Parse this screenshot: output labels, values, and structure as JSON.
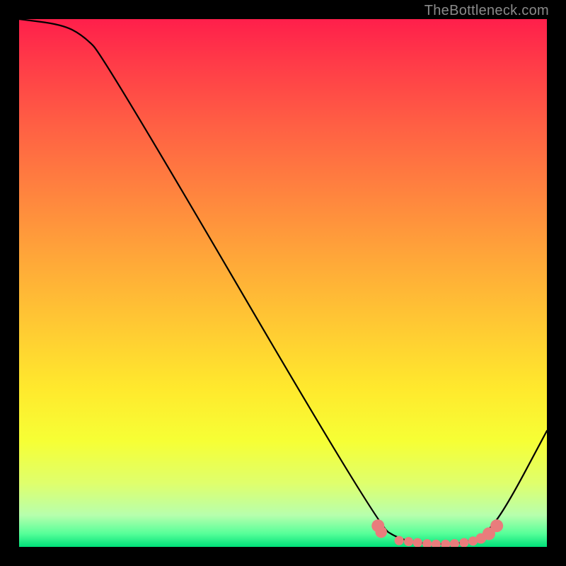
{
  "watermark": "TheBottleneck.com",
  "chart_data": {
    "type": "line",
    "title": "",
    "xlabel": "",
    "ylabel": "",
    "xlim": [
      0,
      100
    ],
    "ylim": [
      0,
      100
    ],
    "curve": [
      {
        "x": 0,
        "y": 100
      },
      {
        "x": 8,
        "y": 99
      },
      {
        "x": 12,
        "y": 97
      },
      {
        "x": 16,
        "y": 93
      },
      {
        "x": 68,
        "y": 4
      },
      {
        "x": 72,
        "y": 1.5
      },
      {
        "x": 76,
        "y": 0.7
      },
      {
        "x": 80,
        "y": 0.5
      },
      {
        "x": 84,
        "y": 0.7
      },
      {
        "x": 88,
        "y": 2
      },
      {
        "x": 92,
        "y": 7
      },
      {
        "x": 100,
        "y": 22
      }
    ],
    "markers": [
      {
        "x": 68.0,
        "y": 4.0,
        "r": 2.2
      },
      {
        "x": 68.6,
        "y": 2.8,
        "r": 2.0
      },
      {
        "x": 72.0,
        "y": 1.2,
        "r": 1.6
      },
      {
        "x": 73.8,
        "y": 1.0,
        "r": 1.6
      },
      {
        "x": 75.5,
        "y": 0.8,
        "r": 1.6
      },
      {
        "x": 77.3,
        "y": 0.6,
        "r": 1.6
      },
      {
        "x": 79.0,
        "y": 0.5,
        "r": 1.6
      },
      {
        "x": 80.8,
        "y": 0.5,
        "r": 1.6
      },
      {
        "x": 82.5,
        "y": 0.6,
        "r": 1.6
      },
      {
        "x": 84.3,
        "y": 0.8,
        "r": 1.6
      },
      {
        "x": 86.0,
        "y": 1.1,
        "r": 1.6
      },
      {
        "x": 87.5,
        "y": 1.6,
        "r": 1.8
      },
      {
        "x": 89.0,
        "y": 2.5,
        "r": 2.2
      },
      {
        "x": 90.5,
        "y": 4.0,
        "r": 2.2
      }
    ],
    "marker_color": "#e97c7c",
    "curve_color": "#000000"
  }
}
